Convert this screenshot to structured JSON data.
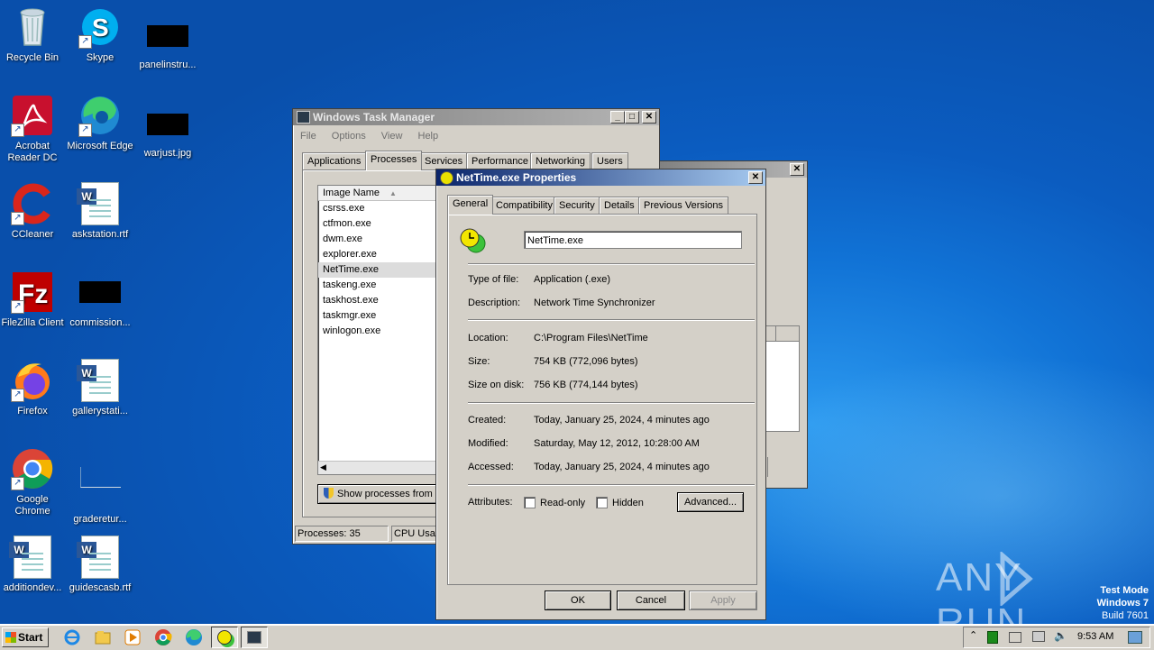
{
  "desktop_icons": [
    {
      "label": "Recycle Bin"
    },
    {
      "label": "Skype"
    },
    {
      "label": "panelinstru..."
    },
    {
      "label": "Acrobat Reader DC"
    },
    {
      "label": "Microsoft Edge"
    },
    {
      "label": "warjust.jpg"
    },
    {
      "label": "CCleaner"
    },
    {
      "label": "askstation.rtf"
    },
    {
      "label": "FileZilla Client"
    },
    {
      "label": "commission..."
    },
    {
      "label": "Firefox"
    },
    {
      "label": "gallerystati..."
    },
    {
      "label": "Google Chrome"
    },
    {
      "label": "graderetur..."
    },
    {
      "label": "additiondev..."
    },
    {
      "label": "guidescasb.rtf"
    }
  ],
  "task_manager": {
    "title": "Windows Task Manager",
    "menu": [
      "File",
      "Options",
      "View",
      "Help"
    ],
    "tabs": [
      "Applications",
      "Processes",
      "Services",
      "Performance",
      "Networking",
      "Users"
    ],
    "column_header": "Image Name",
    "processes": [
      "csrss.exe",
      "ctfmon.exe",
      "dwm.exe",
      "explorer.exe",
      "NetTime.exe",
      "taskeng.exe",
      "taskhost.exe",
      "taskmgr.exe",
      "winlogon.exe"
    ],
    "show_processes_label": "Show processes from",
    "status_processes": "Processes: 35",
    "status_cpu": "CPU Usag"
  },
  "properties": {
    "title": "NetTime.exe Properties",
    "tabs": [
      "General",
      "Compatibility",
      "Security",
      "Details",
      "Previous Versions"
    ],
    "file_name": "NetTime.exe",
    "type_label": "Type of file:",
    "type_value": "Application (.exe)",
    "description_label": "Description:",
    "description_value": "Network Time Synchronizer",
    "location_label": "Location:",
    "location_value": "C:\\Program Files\\NetTime",
    "size_label": "Size:",
    "size_value": "754 KB (772,096 bytes)",
    "size_on_disk_label": "Size on disk:",
    "size_on_disk_value": "756 KB (774,144 bytes)",
    "created_label": "Created:",
    "created_value": "Today, January 25, 2024, 4 minutes ago",
    "modified_label": "Modified:",
    "modified_value": "Saturday, May 12, 2012, 10:28:00 AM",
    "accessed_label": "Accessed:",
    "accessed_value": "Today, January 25, 2024, 4 minutes ago",
    "attributes_label": "Attributes:",
    "readonly_label": "Read-only",
    "hidden_label": "Hidden",
    "advanced_label": "Advanced...",
    "ok_label": "OK",
    "cancel_label": "Cancel",
    "apply_label": "Apply"
  },
  "taskbar": {
    "start_label": "Start",
    "clock": "9:53 AM"
  },
  "watermark": {
    "brand": "ANY RUN",
    "mode": "Test Mode",
    "os": "Windows 7",
    "build": "Build 7601"
  }
}
